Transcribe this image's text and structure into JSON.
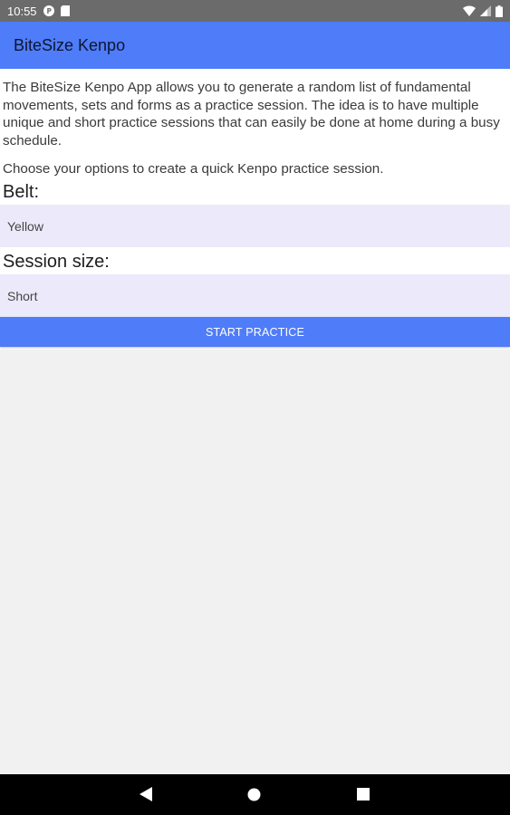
{
  "status_bar": {
    "time": "10:55",
    "icons_left": [
      "notification-p-icon",
      "sd-card-icon"
    ],
    "icons_right": [
      "wifi-icon",
      "cell-signal-icon",
      "battery-icon"
    ]
  },
  "app_bar": {
    "title": "BiteSize Kenpo"
  },
  "main": {
    "intro_text": "The BiteSize Kenpo App allows you to generate a random list of fundamental movements, sets and forms as a practice session. The idea is to have multiple unique and short practice sessions that can easily be done at home during a busy schedule.",
    "choose_text": "Choose your options to create a quick Kenpo practice session.",
    "belt_label": "Belt:",
    "belt_value": "Yellow",
    "session_label": "Session size:",
    "session_value": "Short",
    "start_button": "START PRACTICE"
  },
  "nav_bar": {
    "buttons": [
      "back-icon",
      "home-icon",
      "recents-icon"
    ]
  },
  "colors": {
    "primary": "#4f7cf8",
    "picker_bg": "#ece9fa",
    "status_bar": "#6b6b6b",
    "background": "#f1f1f1"
  }
}
